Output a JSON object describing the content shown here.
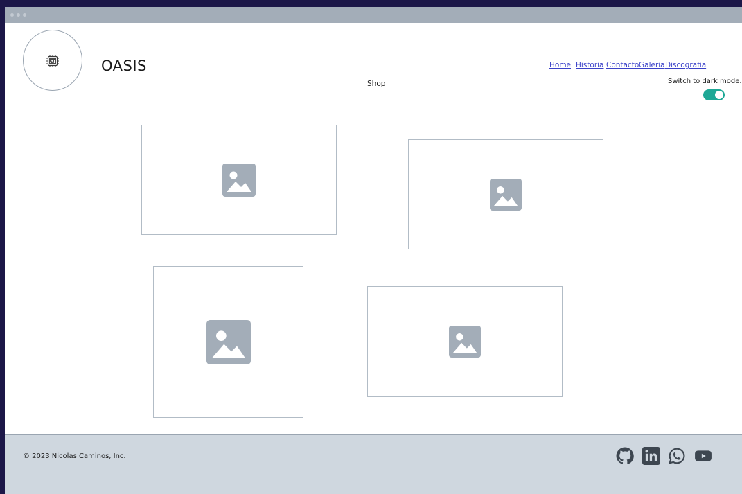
{
  "window": {
    "background": "#ffffff",
    "titlebar_color": "#a3adb8"
  },
  "header": {
    "logo_text": "AI",
    "site_title": "OASIS"
  },
  "nav": {
    "items": [
      {
        "label": "Home"
      },
      {
        "label": "Historia"
      },
      {
        "label": "Contacto"
      },
      {
        "label": "Galeria"
      },
      {
        "label": "Discografia"
      },
      {
        "label": "Shop"
      }
    ],
    "link_color": "#3b42c9"
  },
  "theme_toggle": {
    "label": "Switch to dark mode.",
    "checked": true,
    "color": "#1ea896"
  },
  "gallery": {
    "items": [
      {
        "icon": "image-placeholder-icon"
      },
      {
        "icon": "image-placeholder-icon"
      },
      {
        "icon": "image-placeholder-icon"
      },
      {
        "icon": "image-placeholder-icon"
      }
    ]
  },
  "footer": {
    "copyright": "© 2023 Nicolas Caminos, Inc.",
    "background": "#cfd7df",
    "social": [
      {
        "icon": "github-icon"
      },
      {
        "icon": "linkedin-icon"
      },
      {
        "icon": "whatsapp-icon"
      },
      {
        "icon": "youtube-icon"
      }
    ]
  }
}
